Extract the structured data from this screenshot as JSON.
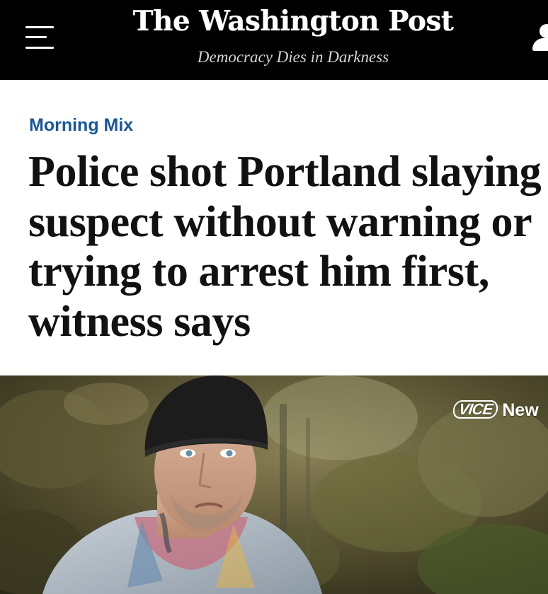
{
  "header": {
    "masthead": "The Washington Post",
    "tagline": "Democracy Dies in Darkness",
    "menu_icon": "hamburger-menu-icon",
    "account_icon": "user-account-icon",
    "background": "#000000"
  },
  "article": {
    "section": "Morning Mix",
    "section_color": "#1a5895",
    "headline": "Police shot Portland slaying suspect without warning or trying to arrest him first, witness says"
  },
  "media": {
    "watermark_logo": "VICE",
    "watermark_text": "New"
  }
}
